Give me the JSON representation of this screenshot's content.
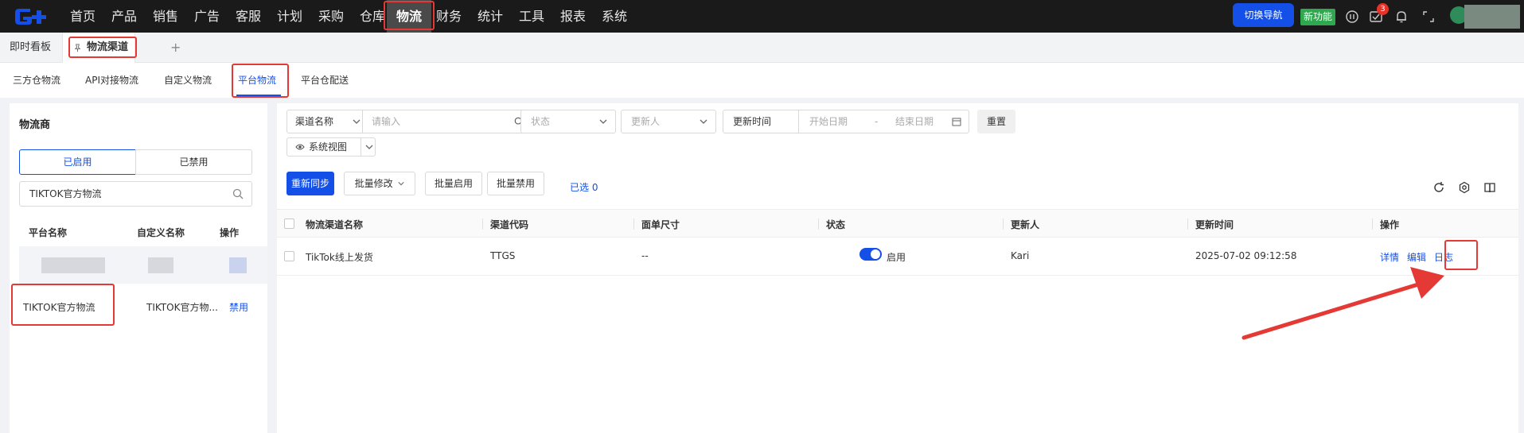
{
  "nav": {
    "items": [
      "首页",
      "产品",
      "销售",
      "广告",
      "客服",
      "计划",
      "采购",
      "仓库",
      "物流",
      "财务",
      "统计",
      "工具",
      "报表",
      "系统"
    ],
    "switch_label": "切换导航",
    "new_feature_label": "新功能",
    "notification_count": "3"
  },
  "page_tabs": {
    "dashboard": "即时看板",
    "current": "物流渠道",
    "plus": "+"
  },
  "sub_tabs": [
    "三方仓物流",
    "API对接物流",
    "自定义物流",
    "平台物流",
    "平台仓配送"
  ],
  "left": {
    "title": "物流商",
    "enabled_label": "已启用",
    "disabled_label": "已禁用",
    "search_value": "TIKTOK官方物流",
    "columns": [
      "平台名称",
      "自定义名称",
      "操作"
    ],
    "row": {
      "platform": "TIKTOK官方物流",
      "custom": "TIKTOK官方物...",
      "action": "禁用"
    }
  },
  "filters": {
    "channel_name_select": "渠道名称",
    "channel_name_placeholder": "请输入",
    "status_placeholder": "状态",
    "updater_placeholder": "更新人",
    "update_time_select": "更新时间",
    "start_date_placeholder": "开始日期",
    "date_sep": "-",
    "end_date_placeholder": "结束日期",
    "reset_label": "重置",
    "system_view_label": "系统视图"
  },
  "toolbar": {
    "resync_label": "重新同步",
    "batch_edit_label": "批量修改",
    "batch_enable_label": "批量启用",
    "batch_disable_label": "批量禁用",
    "selected_label": "已选 0"
  },
  "table": {
    "columns": [
      "物流渠道名称",
      "渠道代码",
      "面单尺寸",
      "状态",
      "更新人",
      "更新时间",
      "操作"
    ],
    "rows": [
      {
        "name": "TikTok线上发货",
        "code": "TTGS",
        "size": "--",
        "status": "启用",
        "status_on": true,
        "updater": "Kari",
        "updated_at": "2025-07-02 09:12:58",
        "actions": [
          "详情",
          "编辑",
          "日志"
        ]
      }
    ]
  },
  "colors": {
    "accent": "#1450e8",
    "highlight": "#e53935",
    "new_feature": "#2fa84f",
    "nav_bg": "#1a1a1a"
  }
}
